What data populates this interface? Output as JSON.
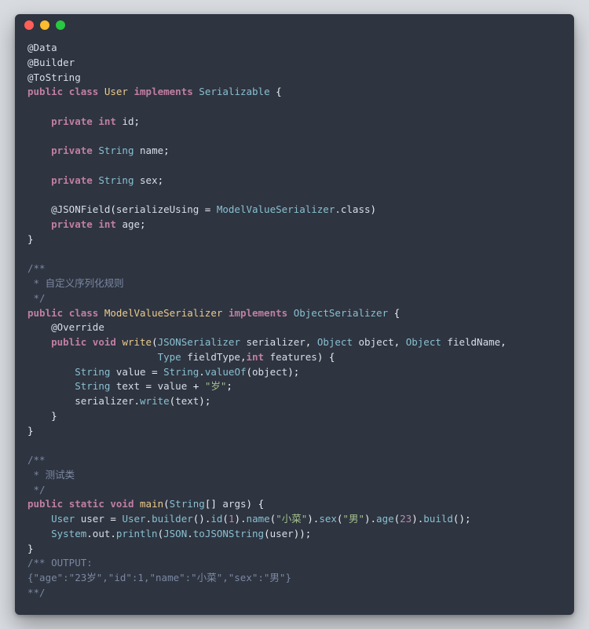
{
  "annotations": {
    "data": "@Data",
    "builder": "@Builder",
    "tostring": "@ToString",
    "override": "@Override",
    "jsonfield": "@JSONField"
  },
  "kw": {
    "public": "public",
    "class": "class",
    "implements": "implements",
    "private": "private",
    "int": "int",
    "void": "void",
    "static": "static"
  },
  "types": {
    "user": "User",
    "serializable": "Serializable",
    "string": "String",
    "modelvalueserializer": "ModelValueSerializer",
    "objectserializer": "ObjectSerializer",
    "jsonserializer": "JSONSerializer",
    "object": "Object",
    "type": "Type",
    "system": "System",
    "json": "JSON"
  },
  "idents": {
    "id": "id",
    "name": "name",
    "sex": "sex",
    "age": "age",
    "serialize_using": "serializeUsing",
    "class_lit": ".class",
    "serializer": "serializer",
    "object": "object",
    "fieldName": "fieldName",
    "fieldType": "fieldType",
    "features": "features",
    "value": "value",
    "text": "text",
    "args": "args",
    "user": "user",
    "out": "out"
  },
  "methods": {
    "write": "write",
    "valueOf": "valueOf",
    "main": "main",
    "builder": "builder",
    "id": "id",
    "name": "name",
    "sex": "sex",
    "age": "age",
    "build": "build",
    "println": "println",
    "toJSONString": "toJSONString"
  },
  "strings": {
    "sui": "\"岁\"",
    "xiaocai": "\"小菜\"",
    "nan": "\"男\""
  },
  "numbers": {
    "one": "1",
    "twentythree": "23"
  },
  "comments": {
    "custom_rule_open": "/**",
    "custom_rule_body": " * 自定义序列化规则",
    "custom_rule_close": " */",
    "test_class_open": "/**",
    "test_class_body": " * 测试类",
    "test_class_close": " */",
    "output_open": "/** OUTPUT:",
    "output_json": "{\"age\":\"23岁\",\"id\":1,\"name\":\"小菜\",\"sex\":\"男\"}",
    "output_close": "**/"
  },
  "punc": {
    "ob": "{",
    "cb": "}",
    "op": "(",
    "cp": ")",
    "obr": "[",
    "cbr": "]",
    "semi": ";",
    "comma": ",",
    "dot": ".",
    "eq": " = ",
    "plus": " + "
  }
}
